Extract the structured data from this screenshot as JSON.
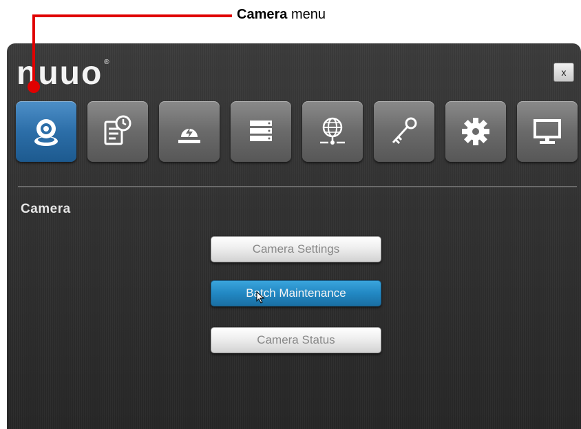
{
  "annotation": {
    "label_bold": "Camera",
    "label_rest": " menu",
    "color": "#e00000"
  },
  "window": {
    "logo": "nuuo",
    "logo_mark": "®",
    "close_label": "x"
  },
  "menu": {
    "items": [
      {
        "icon": "camera-icon",
        "active": true
      },
      {
        "icon": "schedule-icon",
        "active": false
      },
      {
        "icon": "alarm-icon",
        "active": false
      },
      {
        "icon": "storage-icon",
        "active": false
      },
      {
        "icon": "network-icon",
        "active": false
      },
      {
        "icon": "key-icon",
        "active": false
      },
      {
        "icon": "gear-icon",
        "active": false
      },
      {
        "icon": "monitor-icon",
        "active": false
      }
    ]
  },
  "section": {
    "title": "Camera",
    "buttons": [
      {
        "label": "Camera Settings"
      },
      {
        "label": "Batch Maintenance"
      },
      {
        "label": "Camera Status"
      }
    ]
  },
  "colors": {
    "active_blue": "#2c6ea8",
    "button_blue": "#2288c3"
  }
}
